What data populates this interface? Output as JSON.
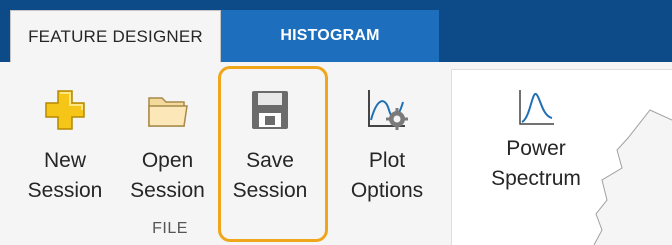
{
  "tabs": {
    "feature_designer": "FEATURE DESIGNER",
    "histogram": "HISTOGRAM"
  },
  "file_section": {
    "label": "FILE",
    "new_session": [
      "New",
      "Session"
    ],
    "open_session": [
      "Open",
      "Session"
    ],
    "save_session": [
      "Save",
      "Session"
    ]
  },
  "plot_options": [
    "Plot",
    "Options"
  ],
  "gallery": {
    "power_spectrum": [
      "Power",
      "Spectrum"
    ]
  },
  "icons": {
    "new_session": "plus-icon",
    "open_session": "folder-icon",
    "save_session": "floppy-disk-icon",
    "plot_options": "plot-gear-icon",
    "power_spectrum": "spectrum-icon"
  },
  "colors": {
    "tabstrip_bg": "#0d4a88",
    "histogram_tab_bg": "#1d6fbd",
    "highlight": "#f0a61a",
    "new_icon_fill": "#f5c518"
  }
}
